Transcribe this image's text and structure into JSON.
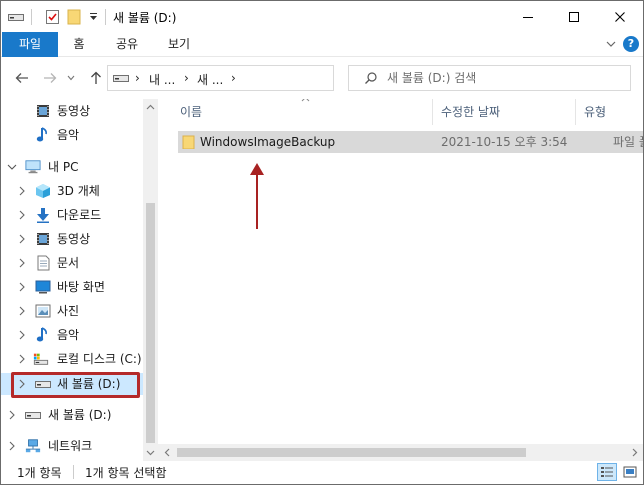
{
  "window": {
    "title": "새 볼륨 (D:)",
    "controls": {
      "minimize": "minimize",
      "maximize": "maximize",
      "close": "close"
    }
  },
  "ribbon": {
    "tabs": [
      {
        "label": "파일",
        "active": true
      },
      {
        "label": "홈"
      },
      {
        "label": "공유"
      },
      {
        "label": "보기"
      }
    ]
  },
  "navigation": {
    "breadcrumb": [
      "내 ...",
      "새 ..."
    ],
    "search_placeholder": "새 볼륨 (D:) 검색"
  },
  "sidebar": {
    "items": [
      {
        "label": "동영상",
        "icon": "video-icon"
      },
      {
        "label": "음악",
        "icon": "music-icon"
      },
      {
        "label": "내 PC",
        "icon": "pc-icon",
        "expanded": true
      },
      {
        "label": "3D 개체",
        "icon": "3d-objects-icon"
      },
      {
        "label": "다운로드",
        "icon": "download-icon"
      },
      {
        "label": "동영상",
        "icon": "video-icon"
      },
      {
        "label": "문서",
        "icon": "document-icon"
      },
      {
        "label": "바탕 화면",
        "icon": "desktop-icon"
      },
      {
        "label": "사진",
        "icon": "pictures-icon"
      },
      {
        "label": "음악",
        "icon": "music-icon"
      },
      {
        "label": "로컬 디스크 (C:)",
        "icon": "local-disk-icon"
      },
      {
        "label": "새 볼륨 (D:)",
        "icon": "drive-icon",
        "selected": true
      },
      {
        "label": "새 볼륨 (D:)",
        "icon": "drive-icon"
      },
      {
        "label": "네트워크",
        "icon": "network-icon"
      }
    ]
  },
  "content": {
    "columns": [
      "이름",
      "수정한 날짜",
      "유형"
    ],
    "rows": [
      {
        "name": "WindowsImageBackup",
        "modified": "2021-10-15 오후 3:54",
        "type": "파일 폴더",
        "icon": "folder-icon",
        "selected": true
      }
    ]
  },
  "statusbar": {
    "item_count": "1개 항목",
    "selection": "1개 항목 선택함"
  },
  "colors": {
    "accent": "#1979ca",
    "selection": "#cce8ff",
    "row_selected": "#d9d9d9",
    "annotation": "#b52a2a"
  }
}
